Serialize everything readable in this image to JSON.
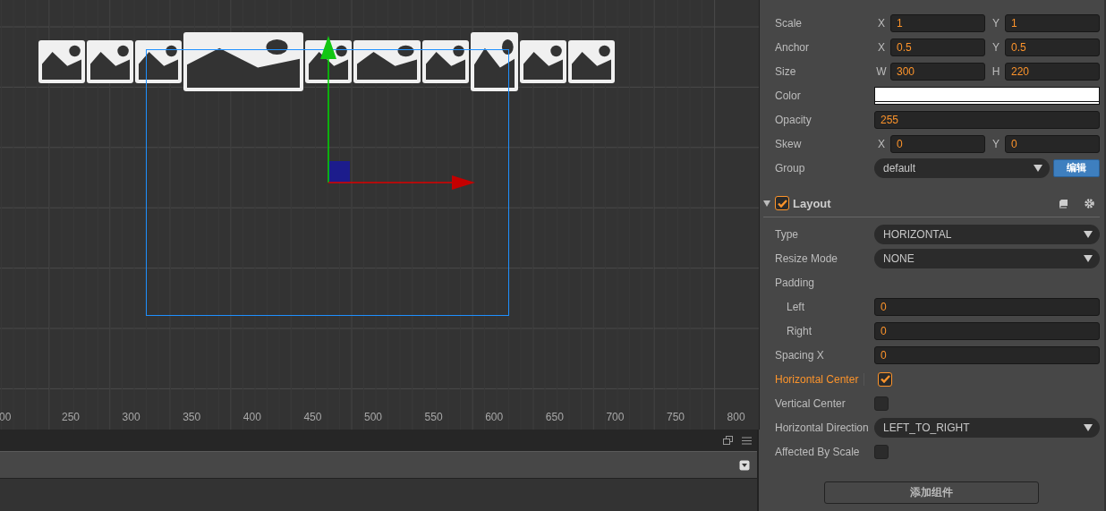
{
  "scene": {
    "ruler_labels": [
      "00",
      "250",
      "300",
      "350",
      "400",
      "450",
      "500",
      "550",
      "600",
      "650",
      "700",
      "750",
      "800"
    ],
    "sprites": [
      {
        "kind": "small"
      },
      {
        "kind": "small"
      },
      {
        "kind": "small"
      },
      {
        "kind": "wide"
      },
      {
        "kind": "small"
      },
      {
        "kind": "medium"
      },
      {
        "kind": "small"
      },
      {
        "kind": "tall"
      },
      {
        "kind": "small"
      },
      {
        "kind": "small"
      }
    ]
  },
  "inspector": {
    "properties": [
      {
        "kind": "xy",
        "label": "Scale",
        "x_label": "X",
        "x_value": "1",
        "y_label": "Y",
        "y_value": "1"
      },
      {
        "kind": "xy",
        "label": "Anchor",
        "x_label": "X",
        "x_value": "0.5",
        "y_label": "Y",
        "y_value": "0.5"
      },
      {
        "kind": "xy",
        "label": "Size",
        "x_label": "W",
        "x_value": "300",
        "y_label": "H",
        "y_value": "220"
      },
      {
        "kind": "color",
        "label": "Color",
        "color": "#ffffff"
      },
      {
        "kind": "field",
        "label": "Opacity",
        "value": "255"
      },
      {
        "kind": "xy",
        "label": "Skew",
        "x_label": "X",
        "x_value": "0",
        "y_label": "Y",
        "y_value": "0"
      },
      {
        "kind": "select",
        "label": "Group",
        "value": "default",
        "button": "编辑"
      }
    ],
    "component": {
      "title": "Layout",
      "enabled": true,
      "expanded": true,
      "properties": [
        {
          "kind": "select",
          "label": "Type",
          "value": "HORIZONTAL"
        },
        {
          "kind": "select",
          "label": "Resize Mode",
          "value": "NONE"
        },
        {
          "kind": "group",
          "label": "Padding",
          "children": [
            {
              "kind": "field",
              "label": "Left",
              "value": "0"
            },
            {
              "kind": "field",
              "label": "Right",
              "value": "0"
            }
          ]
        },
        {
          "kind": "field",
          "label": "Spacing X",
          "value": "0"
        },
        {
          "kind": "check",
          "label": "Horizontal Center",
          "checked": true,
          "modified": true
        },
        {
          "kind": "check",
          "label": "Vertical Center",
          "checked": false,
          "modified": false
        },
        {
          "kind": "select",
          "label": "Horizontal Direction",
          "value": "LEFT_TO_RIGHT"
        },
        {
          "kind": "check",
          "label": "Affected By Scale",
          "checked": false,
          "modified": false
        }
      ]
    },
    "add_button": "添加组件"
  }
}
